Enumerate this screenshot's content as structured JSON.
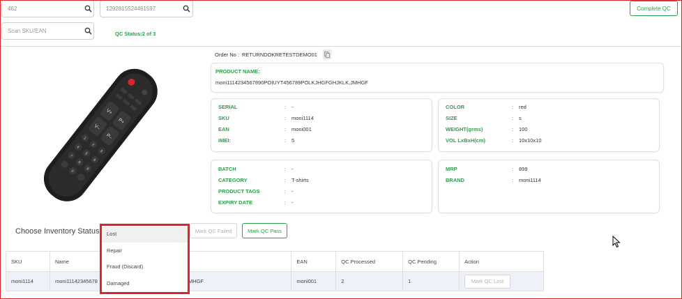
{
  "top": {
    "search_1_value": "462",
    "search_2_value": "1292815524461597",
    "scan_placeholder": "Scan SKU/EAN",
    "qc_status": "QC Status:2 of 3",
    "complete_qc_label": "Complete QC"
  },
  "order": {
    "label": "Order No :",
    "value": "RETURNDOKRETESTDEMO01"
  },
  "product": {
    "name_label": "PRODUCT NAME:",
    "name_value": "moni1114234567890POIUYT456789POLKJHGFGHJKLK,JMHGF"
  },
  "details_left": [
    {
      "key": "SERIAL",
      "colon": ":",
      "value": "-"
    },
    {
      "key": "SKU",
      "colon": ":",
      "value": "moni1114"
    },
    {
      "key": "EAN",
      "colon": ":",
      "value": "moni001"
    },
    {
      "key": "IMEI:",
      "colon": ":",
      "value": "5"
    }
  ],
  "details_right": [
    {
      "key": "COLOR",
      "colon": ":",
      "value": "red"
    },
    {
      "key": "SIZE",
      "colon": ":",
      "value": "s"
    },
    {
      "key": "WEIGHT(grms)",
      "colon": ":",
      "value": "100"
    },
    {
      "key": "VOL LxBxH(cm)",
      "colon": ":",
      "value": "10x10x10"
    }
  ],
  "details_left_2": [
    {
      "key": "BATCH",
      "colon": ":",
      "value": "-"
    },
    {
      "key": "CATEGORY",
      "colon": ":",
      "value": "T-shirts"
    },
    {
      "key": "PRODUCT TAGS",
      "colon": ":",
      "value": "-"
    },
    {
      "key": "EXPIRY DATE",
      "colon": ":",
      "value": "-"
    }
  ],
  "details_right_2": [
    {
      "key": "MRP",
      "colon": ":",
      "value": "899"
    },
    {
      "key": "BRAND",
      "colon": ":",
      "value": "moni1114"
    }
  ],
  "inventory": {
    "choose_label": "Choose Inventory Status",
    "mark_failed_label": "Mark QC Failed",
    "mark_pass_label": "Mark QC Pass",
    "dropdown_options": [
      "Lost",
      "Repair",
      "Fraud (Discard)",
      "Damaged"
    ]
  },
  "table": {
    "headers": [
      "SKU",
      "Name",
      "EAN",
      "QC Processed",
      "QC Pending",
      "Action"
    ],
    "row": {
      "sku": "moni1114",
      "name_visible_start": "moni11142345678",
      "name_visible_end": "MHGF",
      "ean": "moni001",
      "qc_processed": "2",
      "qc_pending": "1",
      "action_label": "Mark QC Lost"
    }
  },
  "colors": {
    "accent_green": "#2e9e4b",
    "highlight_red": "#e0242f"
  }
}
